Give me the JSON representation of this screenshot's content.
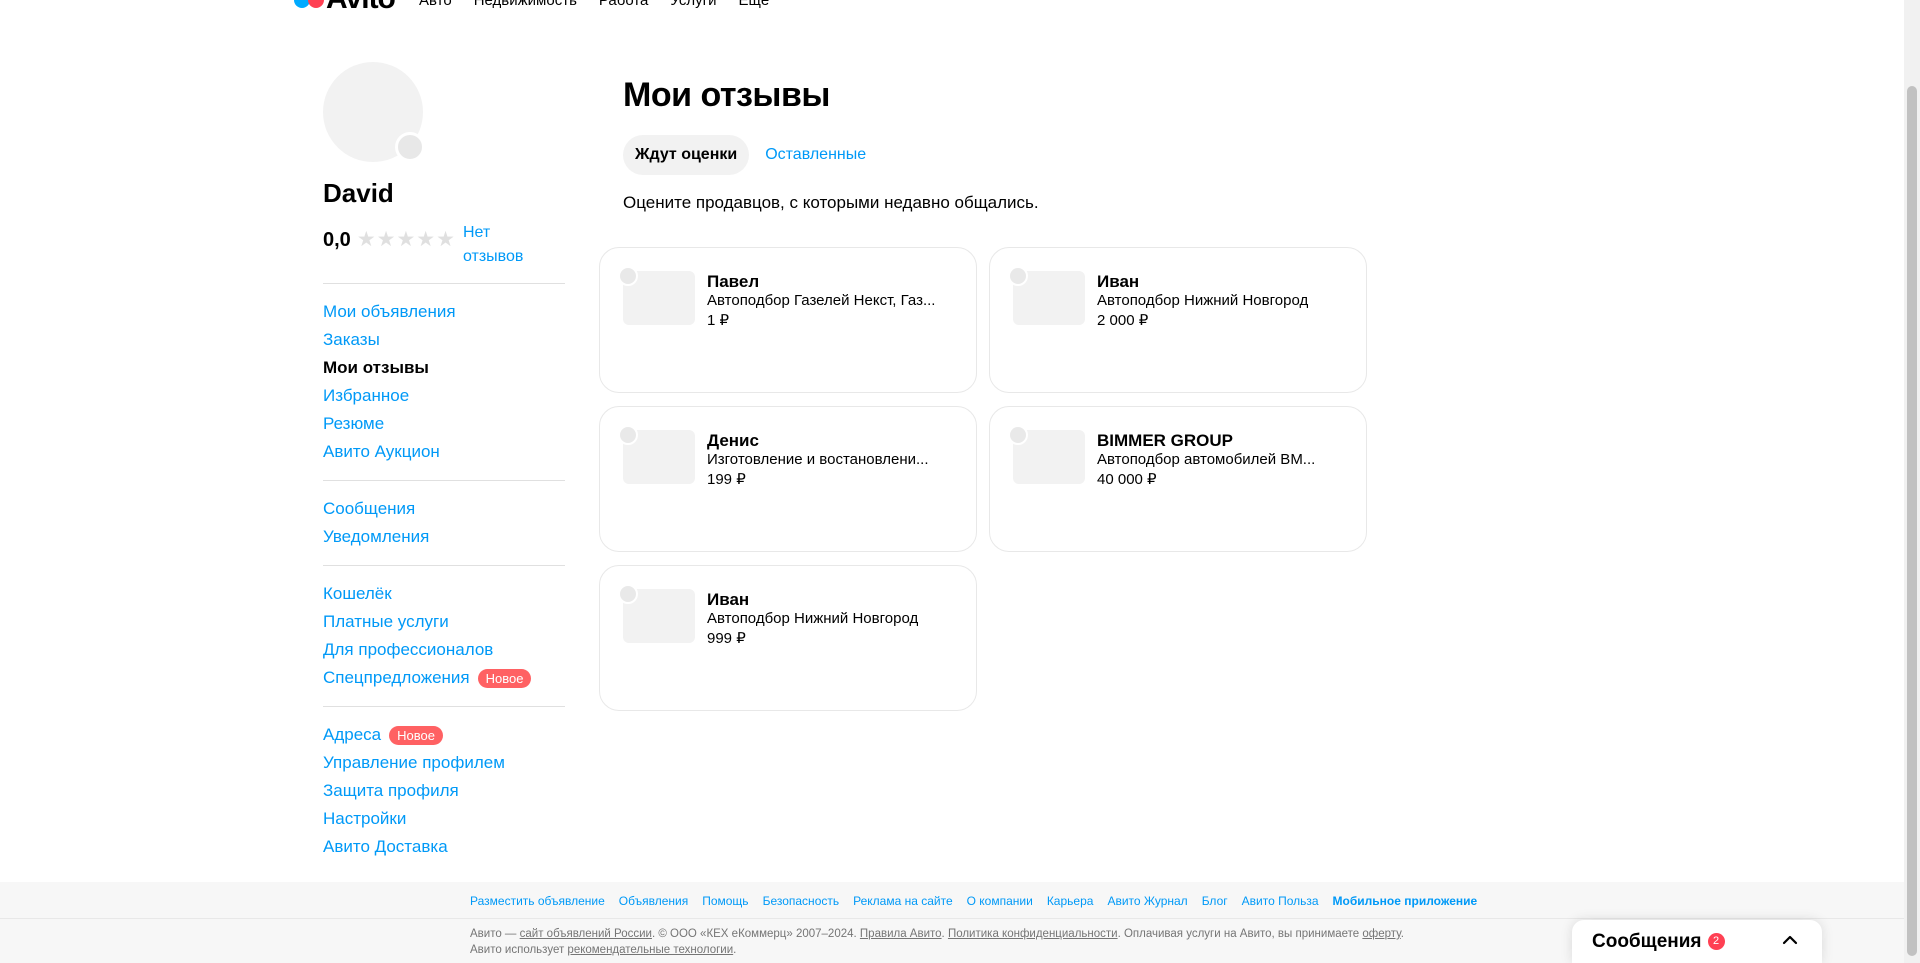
{
  "header": {
    "logo_text": "Avito",
    "nav": [
      "Авто",
      "Недвижимость",
      "Работа",
      "Услуги",
      "Ещё"
    ]
  },
  "profile": {
    "name": "David",
    "rating": "0,0",
    "stars_filled": 0,
    "stars_total": 5,
    "reviews_link": "Нет отзывов"
  },
  "sidebar": {
    "groups": [
      [
        {
          "label": "Мои объявления",
          "active": false
        },
        {
          "label": "Заказы",
          "active": false
        },
        {
          "label": "Мои отзывы",
          "active": true
        },
        {
          "label": "Избранное",
          "active": false
        },
        {
          "label": "Резюме",
          "active": false
        },
        {
          "label": "Авито Аукцион",
          "active": false
        }
      ],
      [
        {
          "label": "Сообщения",
          "active": false
        },
        {
          "label": "Уведомления",
          "active": false
        }
      ],
      [
        {
          "label": "Кошелёк",
          "active": false
        },
        {
          "label": "Платные услуги",
          "active": false
        },
        {
          "label": "Для профессионалов",
          "active": false
        },
        {
          "label": "Спецпредложения",
          "active": false,
          "badge": "Новое"
        }
      ],
      [
        {
          "label": "Адреса",
          "active": false,
          "badge": "Новое"
        },
        {
          "label": "Управление профилем",
          "active": false
        },
        {
          "label": "Защита профиля",
          "active": false
        },
        {
          "label": "Настройки",
          "active": false
        },
        {
          "label": "Авито Доставка",
          "active": false
        }
      ]
    ]
  },
  "main": {
    "title": "Мои отзывы",
    "tabs": [
      {
        "label": "Ждут оценки",
        "active": true
      },
      {
        "label": "Оставленные",
        "active": false
      }
    ],
    "subtitle": "Оцените продавцов, с которыми недавно общались."
  },
  "sellers": [
    {
      "name": "Павел",
      "description": "Автоподбор Газелей Некст, Газ...",
      "price": "1 ₽"
    },
    {
      "name": "Иван",
      "description": "Автоподбор Нижний Новгород",
      "price": "2 000 ₽"
    },
    {
      "name": "Денис",
      "description": "Изготовление и востановлени...",
      "price": "199 ₽"
    },
    {
      "name": "BIMMER GROUP",
      "description": "Автоподбор автомобилей BM...",
      "price": "40 000 ₽"
    },
    {
      "name": "Иван",
      "description": "Автоподбор Нижний Новгород",
      "price": "999 ₽"
    }
  ],
  "footer": {
    "links": [
      "Разместить объявление",
      "Объявления",
      "Помощь",
      "Безопасность",
      "Реклама на сайте",
      "О компании",
      "Карьера",
      "Авито Журнал",
      "Блог",
      "Авито Польза"
    ],
    "app_link": "Мобильное приложение",
    "legal": {
      "p1": "Авито — ",
      "l1": "сайт объявлений России",
      "p2": ". © ООО «КЕХ eКоммерц» 2007–2024. ",
      "l2": "Правила Авито",
      "p3": ". ",
      "l3": "Политика конфиденциальности",
      "p4": ". Оплачивая услуги на Авито, вы принимаете ",
      "l4": "оферту",
      "p5": ". Авито использует ",
      "l5": "рекомендательные технологии",
      "p6": "."
    }
  },
  "messages_widget": {
    "title": "Сообщения",
    "count": "2"
  },
  "colors": {
    "link": "#0099F7",
    "badge": "#FF6163",
    "card_border": "#e8e8e8",
    "placeholder": "#f2f2f2"
  }
}
